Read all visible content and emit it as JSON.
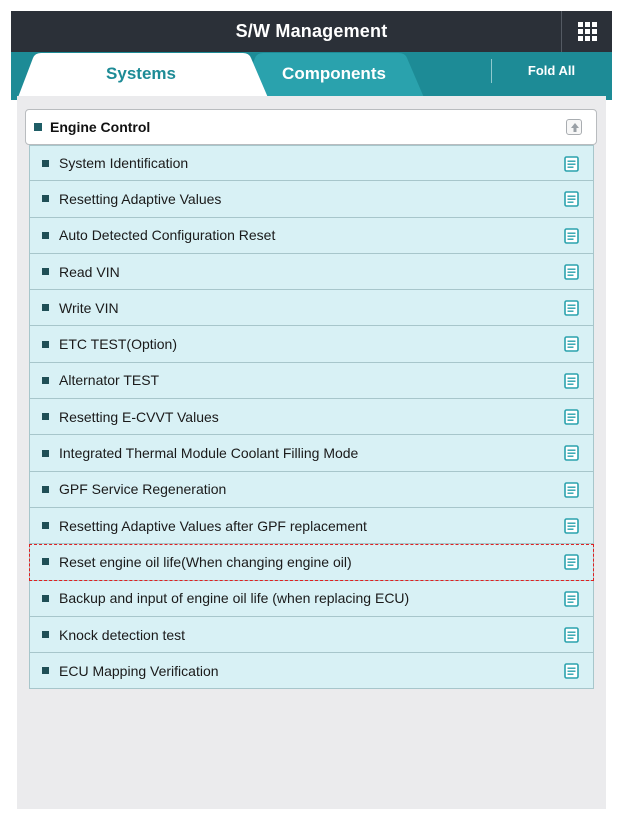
{
  "header": {
    "title": "S/W Management",
    "menu_icon": "grid-menu-icon"
  },
  "tabs": {
    "items": [
      {
        "label": "Systems",
        "active": true
      },
      {
        "label": "Components",
        "active": false
      }
    ],
    "fold_all_label": "Fold All"
  },
  "group": {
    "label": "Engine Control",
    "collapse_icon": "collapse-up-icon",
    "items": [
      {
        "label": "System Identification",
        "icon": "document-icon"
      },
      {
        "label": "Resetting Adaptive Values",
        "icon": "document-icon"
      },
      {
        "label": "Auto Detected Configuration Reset",
        "icon": "document-icon"
      },
      {
        "label": "Read VIN",
        "icon": "document-icon"
      },
      {
        "label": "Write VIN",
        "icon": "document-icon"
      },
      {
        "label": "ETC TEST(Option)",
        "icon": "document-icon"
      },
      {
        "label": "Alternator TEST",
        "icon": "document-icon"
      },
      {
        "label": "Resetting E-CVVT Values",
        "icon": "document-icon"
      },
      {
        "label": "Integrated Thermal Module Coolant Filling Mode",
        "icon": "document-icon"
      },
      {
        "label": "GPF Service Regeneration",
        "icon": "document-icon"
      },
      {
        "label": "Resetting Adaptive Values after GPF replacement",
        "icon": "document-icon"
      },
      {
        "label": "Reset engine oil life(When changing engine oil)",
        "icon": "document-icon",
        "highlighted": true
      },
      {
        "label": "Backup and input of engine oil life (when replacing ECU)",
        "icon": "document-icon"
      },
      {
        "label": "Knock detection test",
        "icon": "document-icon"
      },
      {
        "label": "ECU Mapping Verification",
        "icon": "document-icon"
      }
    ]
  },
  "colors": {
    "header_bg": "#2b3038",
    "tab_bar": "#1d8b96",
    "row_bg": "#d8f1f5",
    "highlight_outline": "#e02020"
  }
}
